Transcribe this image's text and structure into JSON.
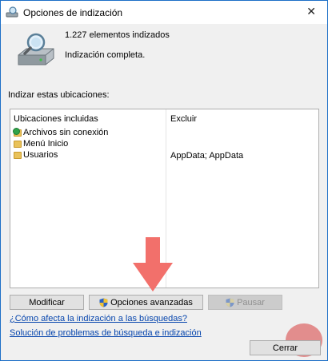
{
  "window": {
    "title": "Opciones de indización",
    "close_glyph": "✕"
  },
  "summary": {
    "count_text": "1.227 elementos indizados",
    "status_text": "Indización completa."
  },
  "locations": {
    "heading": "Indizar estas ubicaciones:",
    "col_included": "Ubicaciones incluidas",
    "col_exclude": "Excluir",
    "rows": [
      {
        "name": "Archivos sin conexión",
        "exclude": "",
        "icon": "offline-folder-icon"
      },
      {
        "name": "Menú Inicio",
        "exclude": "",
        "icon": "folder-icon"
      },
      {
        "name": "Usuarios",
        "exclude": "AppData; AppData",
        "icon": "folder-icon"
      }
    ]
  },
  "buttons": {
    "modify": "Modificar",
    "advanced": "Opciones avanzadas",
    "pause": "Pausar",
    "close": "Cerrar"
  },
  "links": {
    "how_affects": "¿Cómo afecta la indización a las búsquedas?",
    "troubleshoot": "Solución de problemas de búsqueda e indización"
  },
  "colors": {
    "arrow": "#f2706b",
    "link": "#0645ad",
    "accent": "#1c6fc7"
  }
}
